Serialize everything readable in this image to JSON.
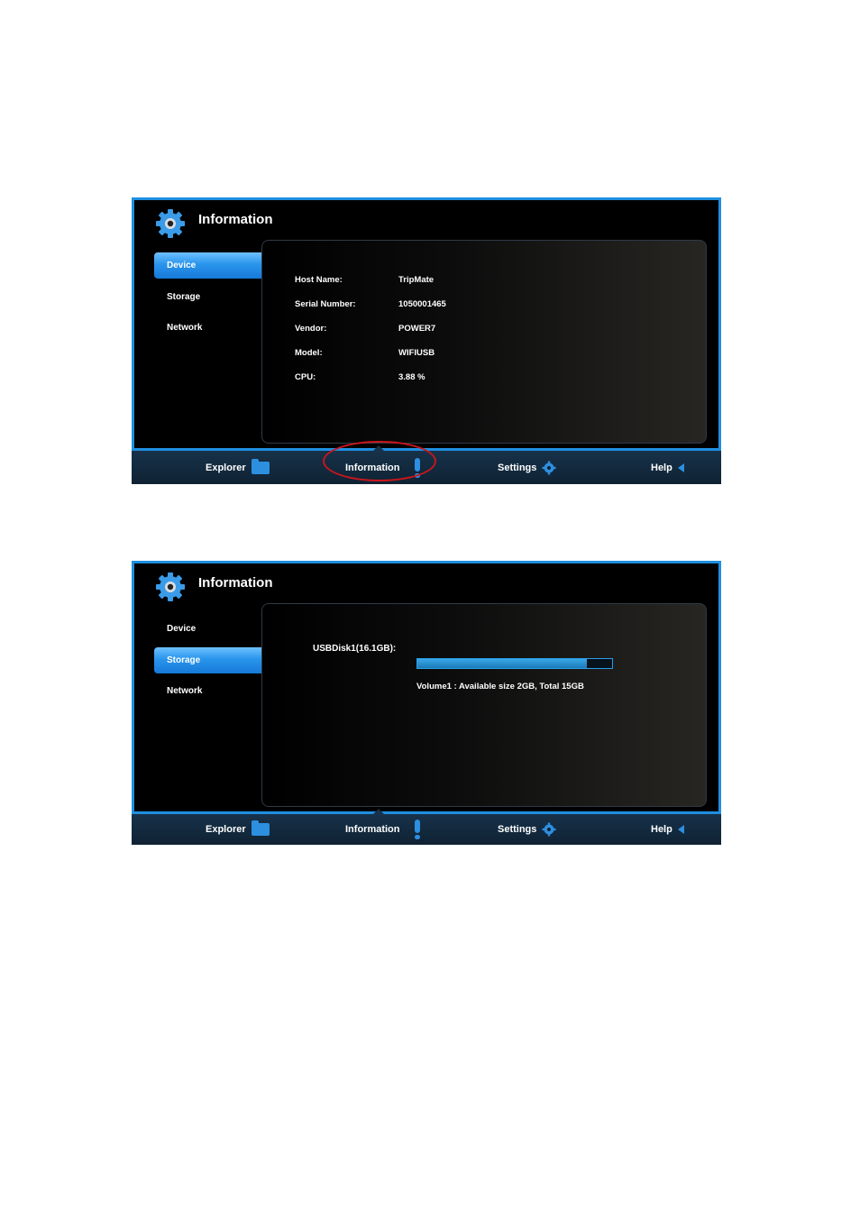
{
  "accent_color": "#1f8fe0",
  "screen1": {
    "title": "Information",
    "title_icon": "gear-icon",
    "sidebar": [
      {
        "label": "Device",
        "active": true
      },
      {
        "label": "Storage",
        "active": false
      },
      {
        "label": "Network",
        "active": false
      }
    ],
    "device_info": [
      {
        "label": "Host Name:",
        "value": "TripMate"
      },
      {
        "label": "Serial Number:",
        "value": "1050001465"
      },
      {
        "label": "Vendor:",
        "value": "POWER7"
      },
      {
        "label": "Model:",
        "value": "WIFIUSB"
      },
      {
        "label": "CPU:",
        "value": "3.88 %"
      }
    ],
    "nav": [
      {
        "label": "Explorer",
        "icon": "folder-icon"
      },
      {
        "label": "Information",
        "icon": "exclamation-icon"
      },
      {
        "label": "Settings",
        "icon": "gear-icon"
      },
      {
        "label": "Help",
        "icon": "triangle-left-icon"
      }
    ],
    "callout_color": "#c8161d"
  },
  "screen2": {
    "title": "Information",
    "title_icon": "gear-icon",
    "sidebar": [
      {
        "label": "Device",
        "active": false
      },
      {
        "label": "Storage",
        "active": true
      },
      {
        "label": "Network",
        "active": false
      }
    ],
    "storage": {
      "disk_label": "USBDisk1(16.1GB):",
      "used_fraction": 0.87,
      "volume_text": "Volume1 : Available size 2GB, Total 15GB"
    },
    "nav": [
      {
        "label": "Explorer",
        "icon": "folder-icon"
      },
      {
        "label": "Information",
        "icon": "exclamation-icon"
      },
      {
        "label": "Settings",
        "icon": "gear-icon"
      },
      {
        "label": "Help",
        "icon": "triangle-left-icon"
      }
    ]
  }
}
